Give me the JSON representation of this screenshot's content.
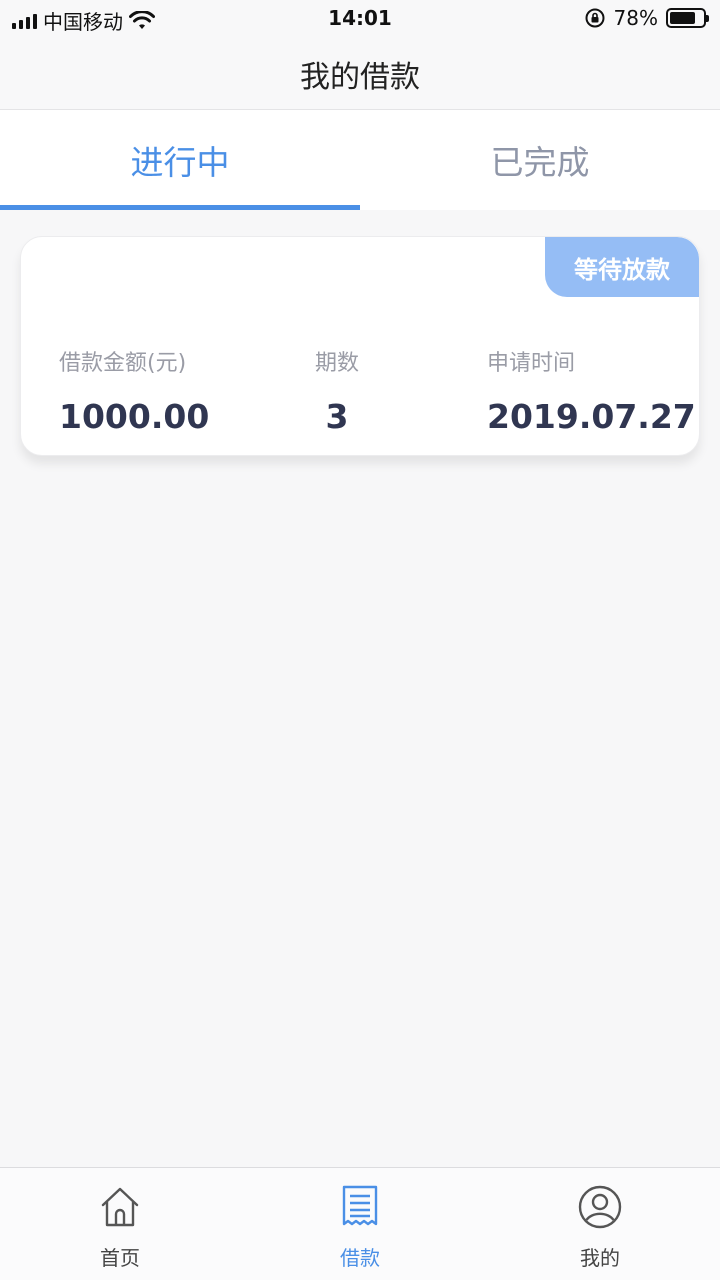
{
  "status_bar": {
    "carrier": "中国移动",
    "time": "14:01",
    "battery": "78%",
    "battery_level": 0.78
  },
  "nav": {
    "title": "我的借款"
  },
  "tabs": [
    {
      "label": "进行中",
      "active": true
    },
    {
      "label": "已完成",
      "active": false
    }
  ],
  "loan_card": {
    "status_badge": "等待放款",
    "amount_label": "借款金额(元)",
    "amount_value": "1000.00",
    "term_label": "期数",
    "term_value": "3",
    "date_label": "申请时间",
    "date_value": "2019.07.27"
  },
  "tabbar": [
    {
      "label": "首页",
      "icon": "home-icon",
      "active": false
    },
    {
      "label": "借款",
      "icon": "receipt-icon",
      "active": true
    },
    {
      "label": "我的",
      "icon": "user-icon",
      "active": false
    }
  ],
  "colors": {
    "accent": "#4a8fe6",
    "badge": "#95bdf5",
    "value_text": "#303651",
    "muted": "#8f96a8"
  }
}
